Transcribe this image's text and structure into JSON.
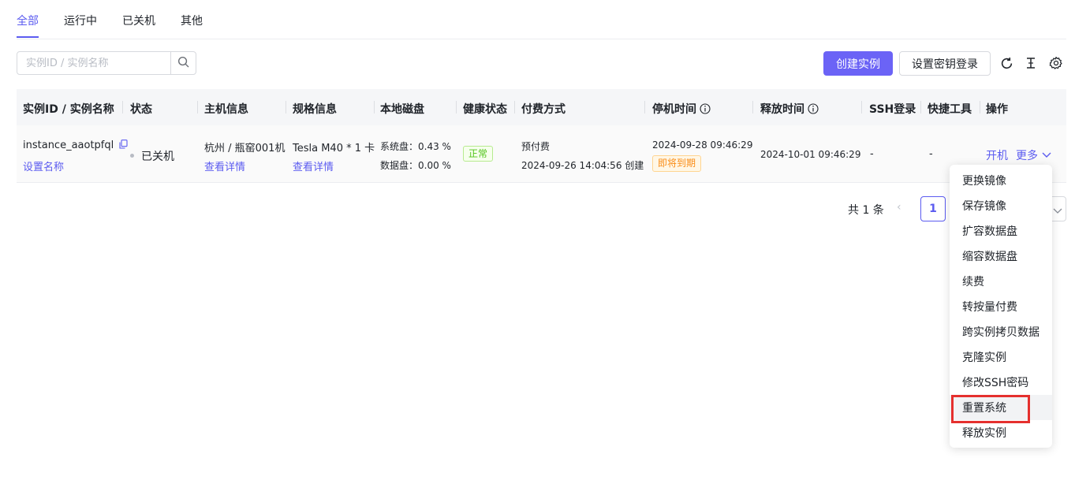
{
  "tabs": [
    {
      "label": "全部",
      "active": true
    },
    {
      "label": "运行中",
      "active": false
    },
    {
      "label": "已关机",
      "active": false
    },
    {
      "label": "其他",
      "active": false
    }
  ],
  "search": {
    "placeholder": "实例ID / 实例名称",
    "value": "",
    "icon": "search-icon"
  },
  "toolbar": {
    "create_label": "创建实例",
    "ssh_key_label": "设置密钥登录",
    "icons": [
      "refresh-icon",
      "text-cursor-icon",
      "settings-gear-icon"
    ]
  },
  "table": {
    "headers": {
      "id": "实例ID / 实例名称",
      "status": "状态",
      "host": "主机信息",
      "spec": "规格信息",
      "disk": "本地磁盘",
      "health": "健康状态",
      "billing": "付费方式",
      "stop_time": "停机时间",
      "release_time": "释放时间",
      "ssh": "SSH登录",
      "tools": "快捷工具",
      "actions": "操作"
    },
    "rows": [
      {
        "instance_id": "instance_aaotpfql",
        "set_name": "设置名称",
        "status": "已关机",
        "host": "杭州 / 瓶窑001机",
        "host_detail": "查看详情",
        "spec": "Tesla M40 * 1 卡",
        "spec_detail": "查看详情",
        "disk_system": "系统盘：0.43 %",
        "disk_data": "数据盘：0.00 %",
        "health": "正常",
        "billing": "预付费",
        "billing_created": "2024-09-26 14:04:56 创建",
        "stop_time": "2024-09-28 09:46:29",
        "stop_badge": "即将到期",
        "release_time": "2024-10-01 09:46:29",
        "ssh": "-",
        "tools": "-",
        "action_start": "开机",
        "action_more": "更多"
      }
    ]
  },
  "pagination": {
    "total_text": "共 1 条",
    "current_page": "1"
  },
  "more_menu": {
    "items": [
      "更换镜像",
      "保存镜像",
      "扩容数据盘",
      "缩容数据盘",
      "续费",
      "转按量付费",
      "跨实例拷贝数据",
      "克隆实例",
      "修改SSH密码",
      "重置系统",
      "释放实例"
    ],
    "hovered": "重置系统"
  },
  "colors": {
    "accent": "#5b5bf0",
    "primary_button": "#6b63f6",
    "success": "#52c41a",
    "warning": "#fa8c16",
    "highlight": "#e5302e"
  }
}
